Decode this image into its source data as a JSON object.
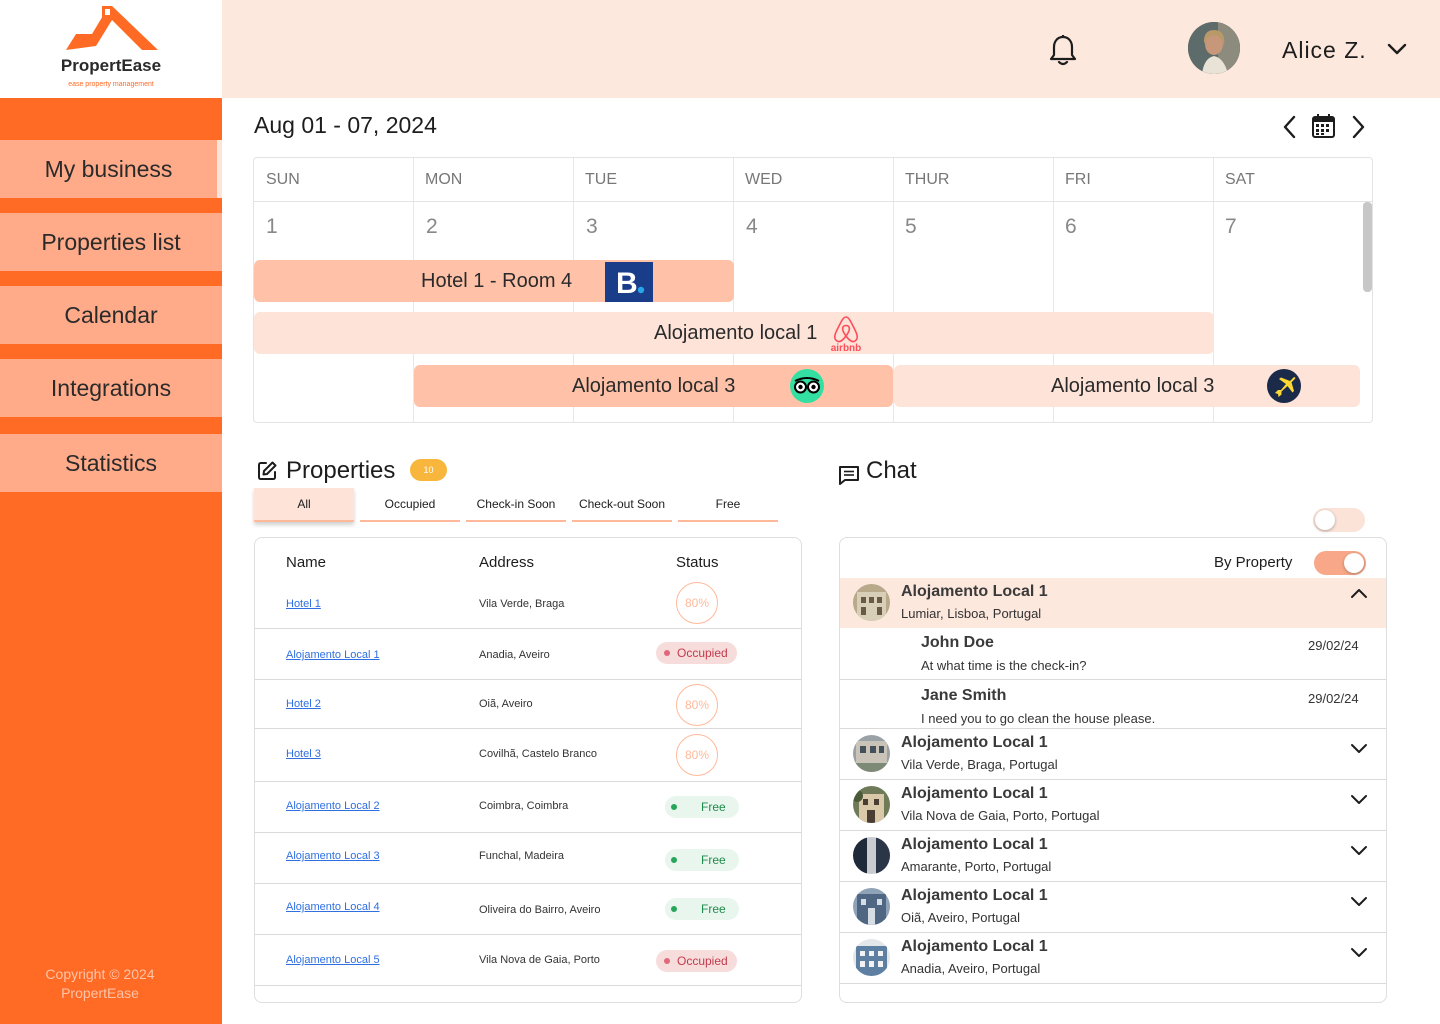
{
  "brand": {
    "name": "PropertEase",
    "tagline": "ease property management",
    "copyright": "Copyright © 2024 PropertEase"
  },
  "sidebar": {
    "items": [
      {
        "label": "My business"
      },
      {
        "label": "Properties list"
      },
      {
        "label": "Calendar"
      },
      {
        "label": "Integrations"
      },
      {
        "label": "Statistics"
      }
    ]
  },
  "header": {
    "user_name": "Alice Z."
  },
  "calendar": {
    "range": "Aug 01 - 07, 2024",
    "days": [
      {
        "name": "SUN",
        "num": "1"
      },
      {
        "name": "MON",
        "num": "2"
      },
      {
        "name": "TUE",
        "num": "3"
      },
      {
        "name": "WED",
        "num": "4"
      },
      {
        "name": "THUR",
        "num": "5"
      },
      {
        "name": "FRI",
        "num": "6"
      },
      {
        "name": "SAT",
        "num": "7"
      }
    ],
    "events": [
      {
        "label": "Hotel  1 - Room 4",
        "source": "booking-icon"
      },
      {
        "label": "Alojamento local 1",
        "source": "airbnb-icon",
        "source_text": "airbnb"
      },
      {
        "label": "Alojamento local 3",
        "source": "tripadvisor-icon"
      },
      {
        "label": "Alojamento local 3",
        "source": "expedia-icon"
      }
    ]
  },
  "properties": {
    "title": "Properties",
    "count": "10",
    "filters": [
      {
        "label": "All"
      },
      {
        "label": "Occupied"
      },
      {
        "label": "Check-in Soon"
      },
      {
        "label": "Check-out Soon"
      },
      {
        "label": "Free"
      }
    ],
    "columns": {
      "name": "Name",
      "address": "Address",
      "status": "Status"
    },
    "rows": [
      {
        "name": "Hotel 1",
        "address": "Vila Verde, Braga",
        "status": "80%"
      },
      {
        "name": "Alojamento Local 1",
        "address": "Anadia, Aveiro",
        "status": "Occupied"
      },
      {
        "name": "Hotel 2",
        "address": "Oiã, Aveiro",
        "status": "80%"
      },
      {
        "name": "Hotel 3",
        "address": "Covilhã, Castelo Branco",
        "status": "80%"
      },
      {
        "name": "Alojamento Local 2",
        "address": "Coimbra, Coimbra",
        "status": "Free"
      },
      {
        "name": "Alojamento Local 3",
        "address": "Funchal, Madeira",
        "status": "Free"
      },
      {
        "name": "Alojamento Local 4",
        "address": "Oliveira do Bairro, Aveiro",
        "status": "Free"
      },
      {
        "name": "Alojamento Local 5",
        "address": "Vila Nova de Gaia, Porto",
        "status": "Occupied"
      }
    ]
  },
  "chat": {
    "title": "Chat",
    "toggle_label": "By Property",
    "open_group": {
      "title": "Alojamento Local 1",
      "location": "Lumiar, Lisboa, Portugal"
    },
    "messages": [
      {
        "name": "John Doe",
        "text": "At  what time is the check-in?",
        "date": "29/02/24"
      },
      {
        "name": "Jane Smith",
        "text": "I need you to go clean the house please.",
        "date": "29/02/24"
      }
    ],
    "groups": [
      {
        "title": "Alojamento Local 1",
        "location": "Vila Verde, Braga, Portugal"
      },
      {
        "title": "Alojamento Local 1",
        "location": "Vila Nova de Gaia, Porto, Portugal"
      },
      {
        "title": "Alojamento Local 1",
        "location": "Amarante, Porto, Portugal"
      },
      {
        "title": "Alojamento Local 1",
        "location": "Oiã, Aveiro, Portugal"
      },
      {
        "title": "Alojamento Local 1",
        "location": "Anadia, Aveiro, Portugal"
      }
    ]
  },
  "colors": {
    "accent": "#ff6a25",
    "nav_item": "#ffab8a",
    "header_bg": "#fde8de",
    "event_dark": "#ffc2a8",
    "event_light": "#fde3d8"
  }
}
